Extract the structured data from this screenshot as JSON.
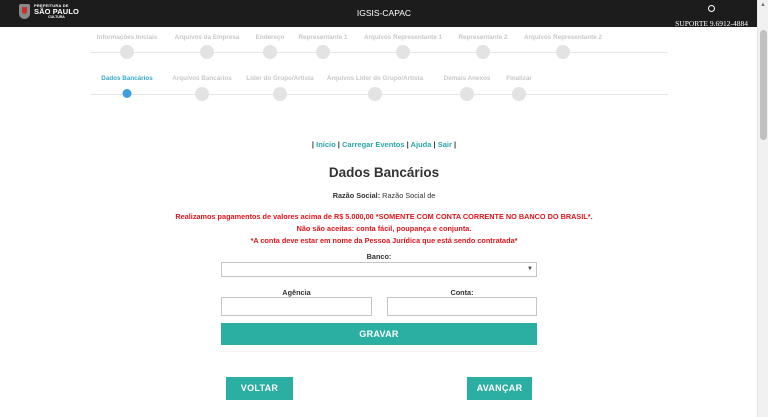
{
  "header": {
    "logo_line1": "PREFEITURA DE",
    "logo_line2": "SÃO PAULO",
    "logo_line3": "CULTURA",
    "title": "IGSIS-CAPAC",
    "support": "SUPORTE 9.6912-4884"
  },
  "steps_row1": [
    {
      "label": "Informações Iniciais"
    },
    {
      "label": "Arquivos da Empresa"
    },
    {
      "label": "Endereço"
    },
    {
      "label": "Representante 1"
    },
    {
      "label": "Arquivos Representante 1"
    },
    {
      "label": "Representante 2"
    },
    {
      "label": "Arquivos Representante 2"
    }
  ],
  "steps_row2": [
    {
      "label": "Dados Bancários",
      "active": true
    },
    {
      "label": "Arquivos Bancários"
    },
    {
      "label": "Líder do Grupo/Artista"
    },
    {
      "label": "Arquivos Líder do Grupo/Artista"
    },
    {
      "label": "Demais Anexos"
    },
    {
      "label": "Finalizar"
    }
  ],
  "nav": {
    "sep": "|",
    "inicio": "Início",
    "carregar": "Carregar Eventos",
    "ajuda": "Ajuda",
    "sair": "Sair"
  },
  "page_title": "Dados Bancários",
  "razao_label": "Razão Social:",
  "razao_value": "Razão Social de",
  "warning": {
    "line1": "Realizamos pagamentos de valores acima de R$ 5.000,00 *SOMENTE COM CONTA CORRENTE NO BANCO DO BRASIL*.",
    "line2": "Não são aceitas: conta fácil, poupança e conjunta.",
    "line3": "*A conta deve estar em nome da Pessoa Jurídica que está sendo contratada*"
  },
  "form": {
    "banco_label": "Banco:",
    "banco_value": "",
    "agencia_label": "Agência",
    "agencia_value": "",
    "conta_label": "Conta:",
    "conta_value": "",
    "gravar": "GRAVAR"
  },
  "buttons": {
    "voltar": "VOLTAR",
    "avancar": "AVANÇAR"
  },
  "colors": {
    "accent": "#2bafa3",
    "warning": "#e3151b",
    "active_step": "#39a9cc"
  }
}
